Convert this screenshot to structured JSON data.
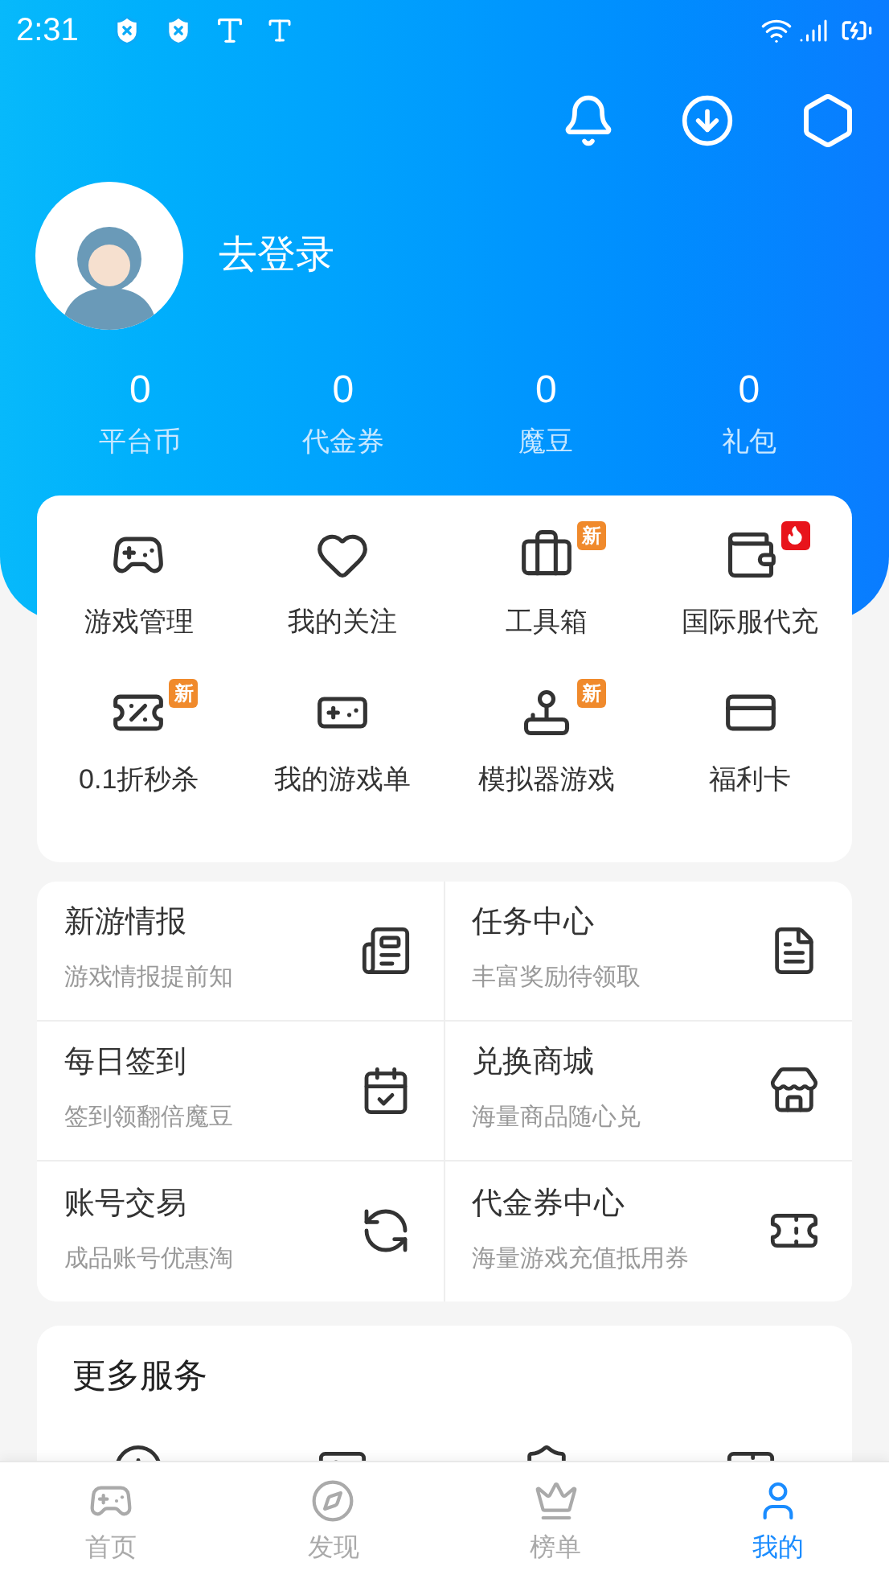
{
  "status_bar": {
    "time": "2:31"
  },
  "profile": {
    "login": "去登录"
  },
  "stats": [
    {
      "value": "0",
      "label": "平台币"
    },
    {
      "value": "0",
      "label": "代金券"
    },
    {
      "value": "0",
      "label": "魔豆"
    },
    {
      "value": "0",
      "label": "礼包"
    }
  ],
  "quick_menu": [
    {
      "label": "游戏管理"
    },
    {
      "label": "我的关注"
    },
    {
      "label": "工具箱",
      "badge": {
        "kind": "new",
        "text": "新"
      }
    },
    {
      "label": "国际服代充",
      "badge": {
        "kind": "hot"
      }
    },
    {
      "label": "0.1折秒杀",
      "badge": {
        "kind": "new",
        "text": "新"
      }
    },
    {
      "label": "我的游戏单"
    },
    {
      "label": "模拟器游戏",
      "badge": {
        "kind": "new",
        "text": "新"
      }
    },
    {
      "label": "福利卡"
    }
  ],
  "features": [
    {
      "title": "新游情报",
      "subtitle": "游戏情报提前知"
    },
    {
      "title": "任务中心",
      "subtitle": "丰富奖励待领取"
    },
    {
      "title": "每日签到",
      "subtitle": "签到领翻倍魔豆"
    },
    {
      "title": "兑换商城",
      "subtitle": "海量商品随心兑"
    },
    {
      "title": "账号交易",
      "subtitle": "成品账号优惠淘"
    },
    {
      "title": "代金券中心",
      "subtitle": "海量游戏充值抵用券"
    }
  ],
  "more_services": {
    "title": "更多服务"
  },
  "bottom_nav": [
    {
      "label": "首页",
      "selected": false
    },
    {
      "label": "发现",
      "selected": false
    },
    {
      "label": "榜单",
      "selected": false
    },
    {
      "label": "我的",
      "selected": true
    }
  ]
}
